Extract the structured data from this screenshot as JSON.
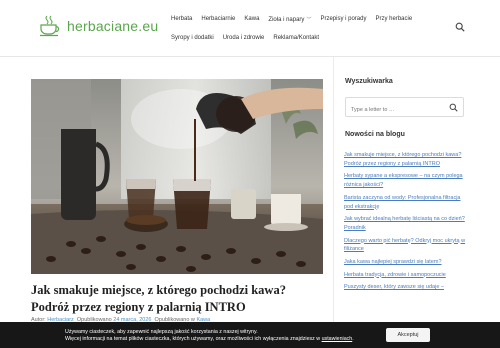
{
  "site": {
    "logo_text": "herbaciane.eu"
  },
  "nav": {
    "row1": [
      {
        "label": "Herbata",
        "has_submenu": false
      },
      {
        "label": "Herbaciarnie",
        "has_submenu": false
      },
      {
        "label": "Kawa",
        "has_submenu": false
      },
      {
        "label": "Zioła i napary",
        "has_submenu": true
      },
      {
        "label": "Przepisy i porady",
        "has_submenu": false
      },
      {
        "label": "Przy herbacie",
        "has_submenu": false
      }
    ],
    "row2": [
      {
        "label": "Syropy i dodatki"
      },
      {
        "label": "Uroda i zdrowie"
      },
      {
        "label": "Reklama/Kontakt"
      }
    ]
  },
  "post": {
    "title": "Jak smakuje miejsce, z którego pochodzi kawa? Podróż przez regiony z palarnią INTRO",
    "meta": {
      "author_prefix": "Autor:",
      "author": "Herbaciarz",
      "published_prefix": "Opublikowano",
      "date": "24 marca, 2026",
      "category_prefix": "Opublikowano w",
      "category": "Kawa"
    }
  },
  "sidebar": {
    "search_heading": "Wyszukiwarka",
    "search_placeholder": "Type a letter to …",
    "news_heading": "Nowości na blogu",
    "posts": [
      "Jak smakuje miejsce, z którego pochodzi kawa? Podróż przez regiony z palarnią INTRO",
      "Herbaty sypane a ekspresowe – na czym polega różnica jakości?",
      "Barista zaczyna od wody: Profesjonalna filtracja pod ekstrakcję",
      "Jak wybrać idealną herbatę liściastą na co dzień? Poradnik",
      "Dlaczego warto pić herbatę? Odkryj moc ukrytą w filiżance",
      "Jaka kawa najlepiej sprawdzi się latem?",
      "Herbata tradycja, zdrowie i samopoczucie",
      "Puszysty deser, który zawsze się udaje –"
    ]
  },
  "cookie": {
    "line1": "Używamy ciasteczek, aby zapewnić najlepszą jakość korzystania z naszej witryny.",
    "line2_prefix": "Więcej informacji na temat plików ciasteczka, których używamy, oraz możliwości ich wyłączenia znajdziesz w",
    "line2_link": "ustawieniach",
    "accept_label": "Akceptuj"
  },
  "colors": {
    "brand": "#5aa64c",
    "link": "#4a7dbf",
    "cookie_bg": "#171717"
  },
  "icons": {
    "logo": "tea-cup-icon",
    "header_search": "search-icon",
    "sidebar_search": "search-icon"
  }
}
